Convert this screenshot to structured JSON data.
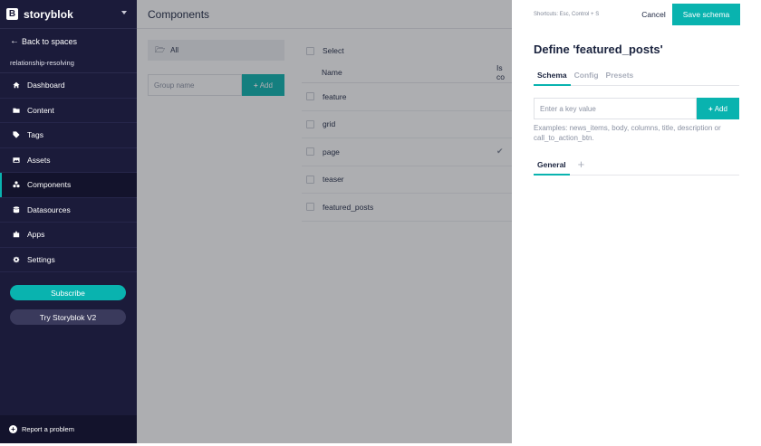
{
  "sidebar": {
    "brand": "storyblok",
    "back_label": "Back to spaces",
    "space_name": "relationship-resolving",
    "items": [
      {
        "label": "Dashboard",
        "icon": "home-icon"
      },
      {
        "label": "Content",
        "icon": "folder-icon"
      },
      {
        "label": "Tags",
        "icon": "tag-icon"
      },
      {
        "label": "Assets",
        "icon": "image-icon"
      },
      {
        "label": "Components",
        "icon": "components-icon",
        "active": true
      },
      {
        "label": "Datasources",
        "icon": "database-icon"
      },
      {
        "label": "Apps",
        "icon": "puzzle-icon"
      },
      {
        "label": "Settings",
        "icon": "gear-icon"
      }
    ],
    "subscribe_label": "Subscribe",
    "try_label": "Try Storyblok V2",
    "report_label": "Report a problem"
  },
  "main": {
    "title": "Components",
    "group_all": "All",
    "group_placeholder": "Group name",
    "group_add": "Add",
    "select_label": "Select",
    "columns": [
      "Name",
      "Is co"
    ],
    "rows": [
      {
        "name": "feature",
        "root": false
      },
      {
        "name": "grid",
        "root": false
      },
      {
        "name": "page",
        "root": true
      },
      {
        "name": "teaser",
        "root": false
      },
      {
        "name": "featured_posts",
        "root": false
      }
    ]
  },
  "panel": {
    "shortcuts": "Shortcuts: Esc, Control + S",
    "cancel_label": "Cancel",
    "save_label": "Save schema",
    "title": "Define 'featured_posts'",
    "tabs": [
      "Schema",
      "Config",
      "Presets"
    ],
    "key_placeholder": "Enter a key value",
    "key_add": "Add",
    "examples": "Examples: news_items, body, columns, title, description or call_to_action_btn.",
    "subtabs": [
      "General"
    ]
  },
  "colors": {
    "accent": "#09b3af",
    "sidebar_bg": "#1b1b3a",
    "text": "#1b243f"
  }
}
